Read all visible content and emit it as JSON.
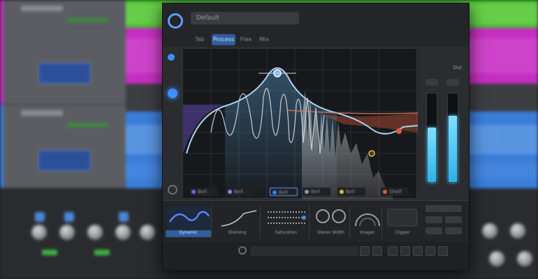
{
  "plugin": {
    "preset_name": "Default",
    "top_tabs": [
      "Tab",
      "Process",
      "Flex",
      "Mix"
    ],
    "output_label": "Out",
    "band_labels": [
      "Bell",
      "Bell",
      "Bell",
      "Bell",
      "Bell",
      "Shelf"
    ],
    "band_colors": [
      "#7d5cff",
      "#9a7dff",
      "#2e8bff",
      "#8aa0b0",
      "#e0c23a",
      "#e65a3c"
    ],
    "modules": [
      "Dynamic",
      "Shelving",
      "Saturation",
      "Stereo Width",
      "Imager",
      "Clipper"
    ],
    "meter_levels": [
      0.62,
      0.75
    ],
    "meter_color": "#49c6ff"
  },
  "daw": {
    "track_colors": [
      "#55c838",
      "#c62fc0",
      "#3b7dd8"
    ]
  }
}
